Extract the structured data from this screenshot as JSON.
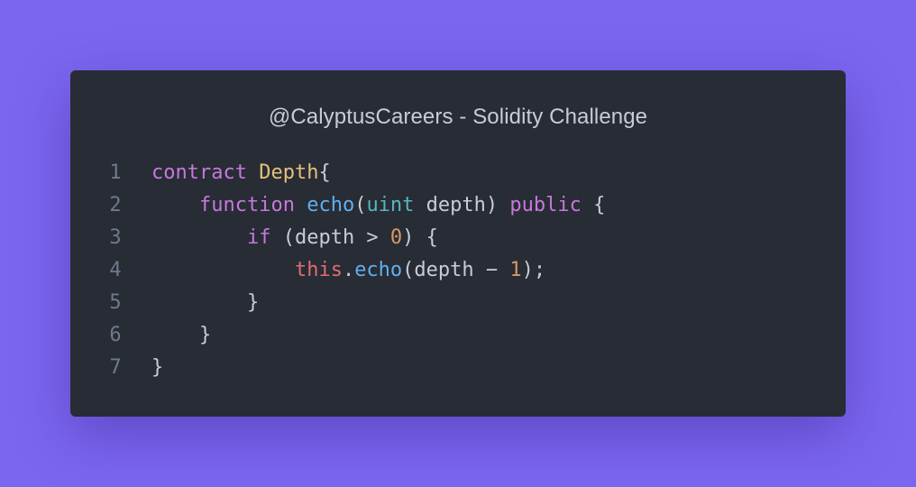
{
  "title": "@CalyptusCareers - Solidity Challenge",
  "lines": [
    {
      "number": "1",
      "tokens": [
        {
          "t": "contract",
          "c": "kw"
        },
        {
          "t": " ",
          "c": "pl"
        },
        {
          "t": "Depth",
          "c": "cls"
        },
        {
          "t": "{",
          "c": "pl"
        }
      ]
    },
    {
      "number": "2",
      "tokens": [
        {
          "t": "    ",
          "c": "pl"
        },
        {
          "t": "function",
          "c": "kw"
        },
        {
          "t": " ",
          "c": "pl"
        },
        {
          "t": "echo",
          "c": "fn"
        },
        {
          "t": "(",
          "c": "pl"
        },
        {
          "t": "uint",
          "c": "ty"
        },
        {
          "t": " depth) ",
          "c": "pl"
        },
        {
          "t": "public",
          "c": "kw"
        },
        {
          "t": " {",
          "c": "pl"
        }
      ]
    },
    {
      "number": "3",
      "tokens": [
        {
          "t": "        ",
          "c": "pl"
        },
        {
          "t": "if",
          "c": "kw"
        },
        {
          "t": " (depth > ",
          "c": "pl"
        },
        {
          "t": "0",
          "c": "num"
        },
        {
          "t": ") {",
          "c": "pl"
        }
      ]
    },
    {
      "number": "4",
      "tokens": [
        {
          "t": "            ",
          "c": "pl"
        },
        {
          "t": "this",
          "c": "th"
        },
        {
          "t": ".",
          "c": "pl"
        },
        {
          "t": "echo",
          "c": "fn"
        },
        {
          "t": "(depth − ",
          "c": "pl"
        },
        {
          "t": "1",
          "c": "num"
        },
        {
          "t": ");",
          "c": "pl"
        }
      ]
    },
    {
      "number": "5",
      "tokens": [
        {
          "t": "        }",
          "c": "pl"
        }
      ]
    },
    {
      "number": "6",
      "tokens": [
        {
          "t": "    }",
          "c": "pl"
        }
      ]
    },
    {
      "number": "7",
      "tokens": [
        {
          "t": "}",
          "c": "pl"
        }
      ]
    }
  ],
  "colors": {
    "background": "#7b66f0",
    "window": "#282c34",
    "keyword": "#c678dd",
    "class": "#e5c07b",
    "function": "#61afef",
    "type": "#56b6c2",
    "number": "#d19a66",
    "this": "#e06c75",
    "plain": "#c8ccd4",
    "line_number": "#6e7a8e"
  }
}
